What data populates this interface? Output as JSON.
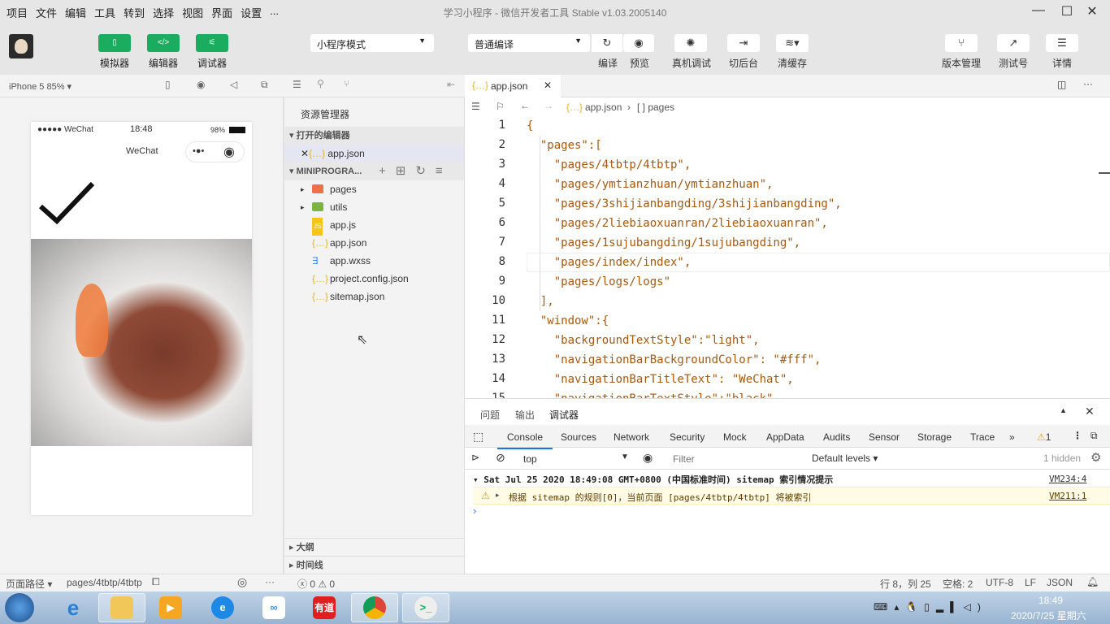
{
  "menubar": {
    "items": [
      "项目",
      "文件",
      "编辑",
      "工具",
      "转到",
      "选择",
      "视图",
      "界面",
      "设置",
      "..."
    ],
    "title": "学习小程序 - 微信开发者工具 Stable v1.03.2005140"
  },
  "toolbar": {
    "simulator": "模拟器",
    "editor": "编辑器",
    "debugger": "调试器",
    "mode_select": "小程序模式",
    "compile_select": "普通编译",
    "compile": "编译",
    "preview": "预览",
    "remote_debug": "真机调试",
    "background": "切后台",
    "clear_cache": "清缓存",
    "version": "版本管理",
    "test_account": "测试号",
    "details": "详情",
    "accent": "#1aad5f"
  },
  "simulator": {
    "device": "iPhone 5 85% ▾",
    "status_signal": "●●●●● WeChat",
    "time": "18:48",
    "battery": "98%",
    "nav_title": "WeChat",
    "capsule_more": "•●•"
  },
  "explorer": {
    "title": "资源管理器",
    "open_editors": "打开的编辑器",
    "open_file": "app.json",
    "project": "MINIPROGRA...",
    "files": [
      {
        "name": "pages",
        "type": "folder",
        "color": "#f06e4a"
      },
      {
        "name": "utils",
        "type": "folder",
        "color": "#7cb342"
      },
      {
        "name": "app.js",
        "type": "js"
      },
      {
        "name": "app.json",
        "type": "json"
      },
      {
        "name": "app.wxss",
        "type": "wxss"
      },
      {
        "name": "project.config.json",
        "type": "json"
      },
      {
        "name": "sitemap.json",
        "type": "json"
      }
    ],
    "outline": "大纲",
    "timeline": "时间线"
  },
  "editor": {
    "tab": "app.json",
    "breadcrumb_file": "app.json",
    "breadcrumb_sep": "›",
    "breadcrumb_node": "[ ] pages",
    "lines": [
      "{",
      "  \"pages\":[",
      "    \"pages/4tbtp/4tbtp\",",
      "    \"pages/ymtianzhuan/ymtianzhuan\",",
      "    \"pages/3shijianbangding/3shijianbangding\",",
      "    \"pages/2liebiaoxuanran/2liebiaoxuanran\",",
      "    \"pages/1sujubangding/1sujubangding\",",
      "    \"pages/index/index\",",
      "    \"pages/logs/logs\"",
      "  ],",
      "  \"window\":{",
      "    \"backgroundTextStyle\":\"light\",",
      "    \"navigationBarBackgroundColor\": \"#fff\",",
      "    \"navigationBarTitleText\": \"WeChat\",",
      "    \"navigationBarTextStyle\":\"black\","
    ]
  },
  "console": {
    "panel_tabs": [
      "问题",
      "输出",
      "调试器"
    ],
    "tabs": [
      "Console",
      "Sources",
      "Network",
      "Security",
      "Mock",
      "AppData",
      "Audits",
      "Sensor",
      "Storage",
      "Trace",
      "»"
    ],
    "warn_count": "1",
    "context": "top",
    "filter_placeholder": "Filter",
    "levels": "Default levels ▾",
    "hidden": "1 hidden",
    "group": "Sat Jul 25 2020 18:49:08 GMT+0800 (中国标准时间) sitemap 索引情况提示",
    "group_src": "VM234:4",
    "warning": "根据 sitemap 的规则[0]，当前页面 [pages/4tbtp/4tbtp] 将被索引",
    "warning_src": "VM211:1",
    "prompt": "›"
  },
  "statusbar": {
    "page_path_label": "页面路径 ▾",
    "page_path": "pages/4tbtp/4tbtp",
    "errors": "ⓧ 0 ⚠ 0",
    "position": "行 8，列 25",
    "spaces": "空格: 2",
    "encoding": "UTF-8",
    "eol": "LF",
    "language": "JSON"
  },
  "taskbar": {
    "time": "18:49",
    "date": "2020/7/25 星期六",
    "youdao": "有道"
  }
}
